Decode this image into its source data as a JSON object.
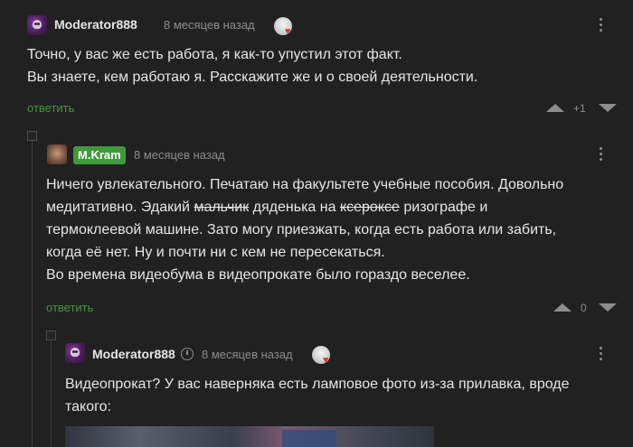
{
  "comments": [
    {
      "username": "Moderator888",
      "time": "8 месяцев назад",
      "line1": "Точно, у вас же есть работа, я как-то упустил этот факт.",
      "line2": "Вы знаете, кем работаю я. Расскажите же и о своей деятельности.",
      "reply_label": "ответить",
      "rating": "+1"
    },
    {
      "username": "M.Kram",
      "time": "8 месяцев назад",
      "line1": "Ничего увлекательного. Печатаю на факультете учебные пособия. Довольно",
      "line2_a": "медитативно. Эдакий ",
      "line2_strike1": "мальчик",
      "line2_b": " дяденька на ",
      "line2_strike2": "ксероксе",
      "line2_c": " ризографе и",
      "line3": "термоклеевой машине. Зато могу приезжать, когда есть работа или забить,",
      "line4": "когда её нет. Ну и почти ни с кем не пересекаться.",
      "line5": "Во времена видеобума в видеопрокате было гораздо веселее.",
      "reply_label": "ответить",
      "rating": "0"
    },
    {
      "username": "Moderator888",
      "time": "8 месяцев назад",
      "line1": "Видеопрокат? У вас наверняка есть ламповое фото из-за прилавка, вроде",
      "line2": "такого:"
    }
  ],
  "colors": {
    "background": "#212121",
    "accent_green": "#3e9a3a",
    "muted": "#8d8d8d"
  }
}
